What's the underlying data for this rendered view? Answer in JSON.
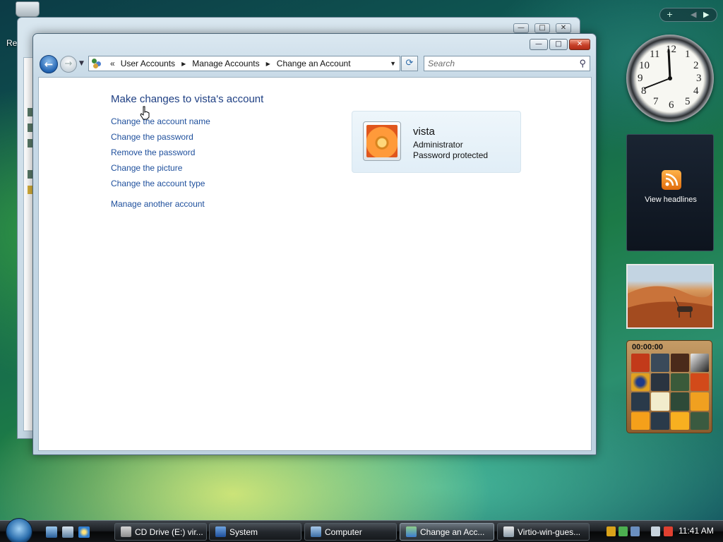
{
  "desktop": {
    "recycle_label": "Re"
  },
  "window": {
    "title_buttons": {
      "minimize": "—",
      "maximize": "□",
      "close": "✕"
    },
    "address": {
      "overflow": "«",
      "crumbs": [
        "User Accounts",
        "Manage Accounts",
        "Change an Account"
      ]
    },
    "search_placeholder": "Search",
    "heading": "Make changes to vista's account",
    "tasks": [
      "Change the account name",
      "Change the password",
      "Remove the password",
      "Change the picture",
      "Change the account type"
    ],
    "other_task": "Manage another account",
    "account": {
      "name": "vista",
      "type": "Administrator",
      "status": "Password protected"
    }
  },
  "gadgets": {
    "clock_numbers": [
      "12",
      "1",
      "2",
      "3",
      "4",
      "5",
      "6",
      "7",
      "8",
      "9",
      "10",
      "11"
    ],
    "rss_label": "View headlines",
    "puzzle_timer": "00:00:00"
  },
  "taskbar": {
    "buttons": [
      {
        "label": "CD Drive (E:) vir...",
        "icon": "cd-drive-icon",
        "active": false
      },
      {
        "label": "System",
        "icon": "system-icon",
        "active": false
      },
      {
        "label": "Computer",
        "icon": "computer-icon",
        "active": false
      },
      {
        "label": "Change an Acc...",
        "icon": "user-accounts-icon",
        "active": true
      },
      {
        "label": "Virtio-win-gues...",
        "icon": "installer-icon",
        "active": false
      }
    ],
    "time": "11:41 AM"
  },
  "colors": {
    "link": "#1e4f9c",
    "heading": "#1e3f83",
    "close_button": "#c8422a"
  }
}
